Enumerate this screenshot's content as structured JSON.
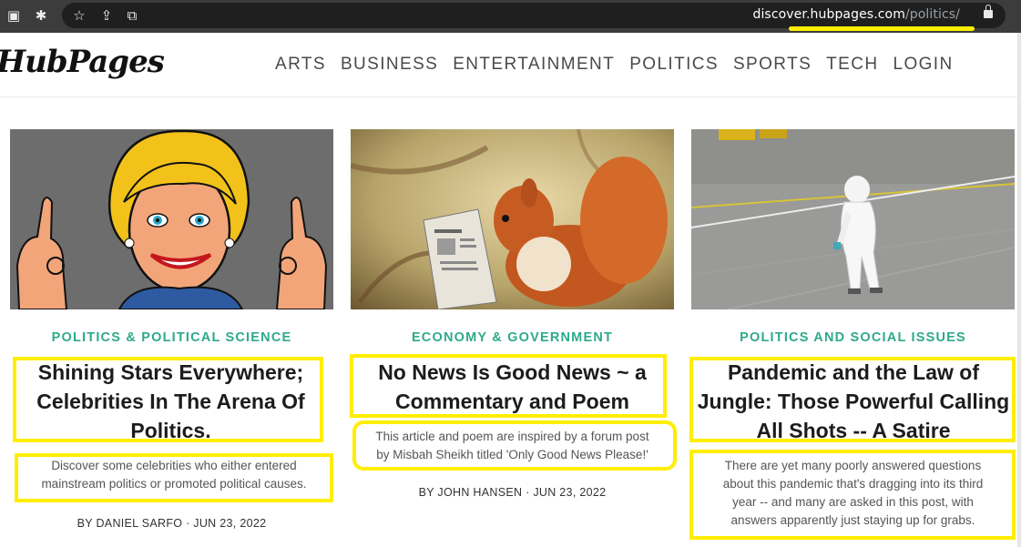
{
  "browser": {
    "url_host": "discover.hubpages.com",
    "url_path": "/politics/"
  },
  "header": {
    "logo": "HubPages",
    "nav": [
      "ARTS",
      "BUSINESS",
      "ENTERTAINMENT",
      "POLITICS",
      "SPORTS",
      "TECH",
      "LOGIN"
    ]
  },
  "articles": [
    {
      "category": "POLITICS & POLITICAL SCIENCE",
      "title_lines": [
        "Shining Stars Everywhere;",
        "Celebrities In The Arena Of",
        "Politics."
      ],
      "summary_lines": [
        "Discover some celebrities who either entered",
        "mainstream politics or promoted political causes."
      ],
      "byline": "BY DANIEL SARFO  ·  JUN 23, 2022",
      "image": "cartoon-politician-ok-hands"
    },
    {
      "category": "ECONOMY & GOVERNMENT",
      "title_lines": [
        "No News Is Good News ~ a",
        "Commentary and Poem"
      ],
      "summary_lines": [
        "This article and poem are inspired by a forum post",
        "by Misbah Sheikh titled 'Only Good News Please!'"
      ],
      "byline": "BY JOHN HANSEN  ·  JUN 23, 2022",
      "image": "squirrel-reading-newspaper"
    },
    {
      "category": "POLITICS AND SOCIAL ISSUES",
      "title_lines": [
        "Pandemic and the Law of",
        "Jungle: Those Powerful Calling",
        "All Shots -- A Satire"
      ],
      "summary_lines": [
        "There are yet many poorly answered questions",
        "about this pandemic that's dragging into its third",
        "year -- and many are asked in this post, with",
        "answers apparently just staying up for grabs."
      ],
      "byline": "",
      "image": "hazmat-worker-on-tarmac"
    }
  ],
  "colors": {
    "accent": "#2eaa8a",
    "highlight": "#ffee00"
  }
}
